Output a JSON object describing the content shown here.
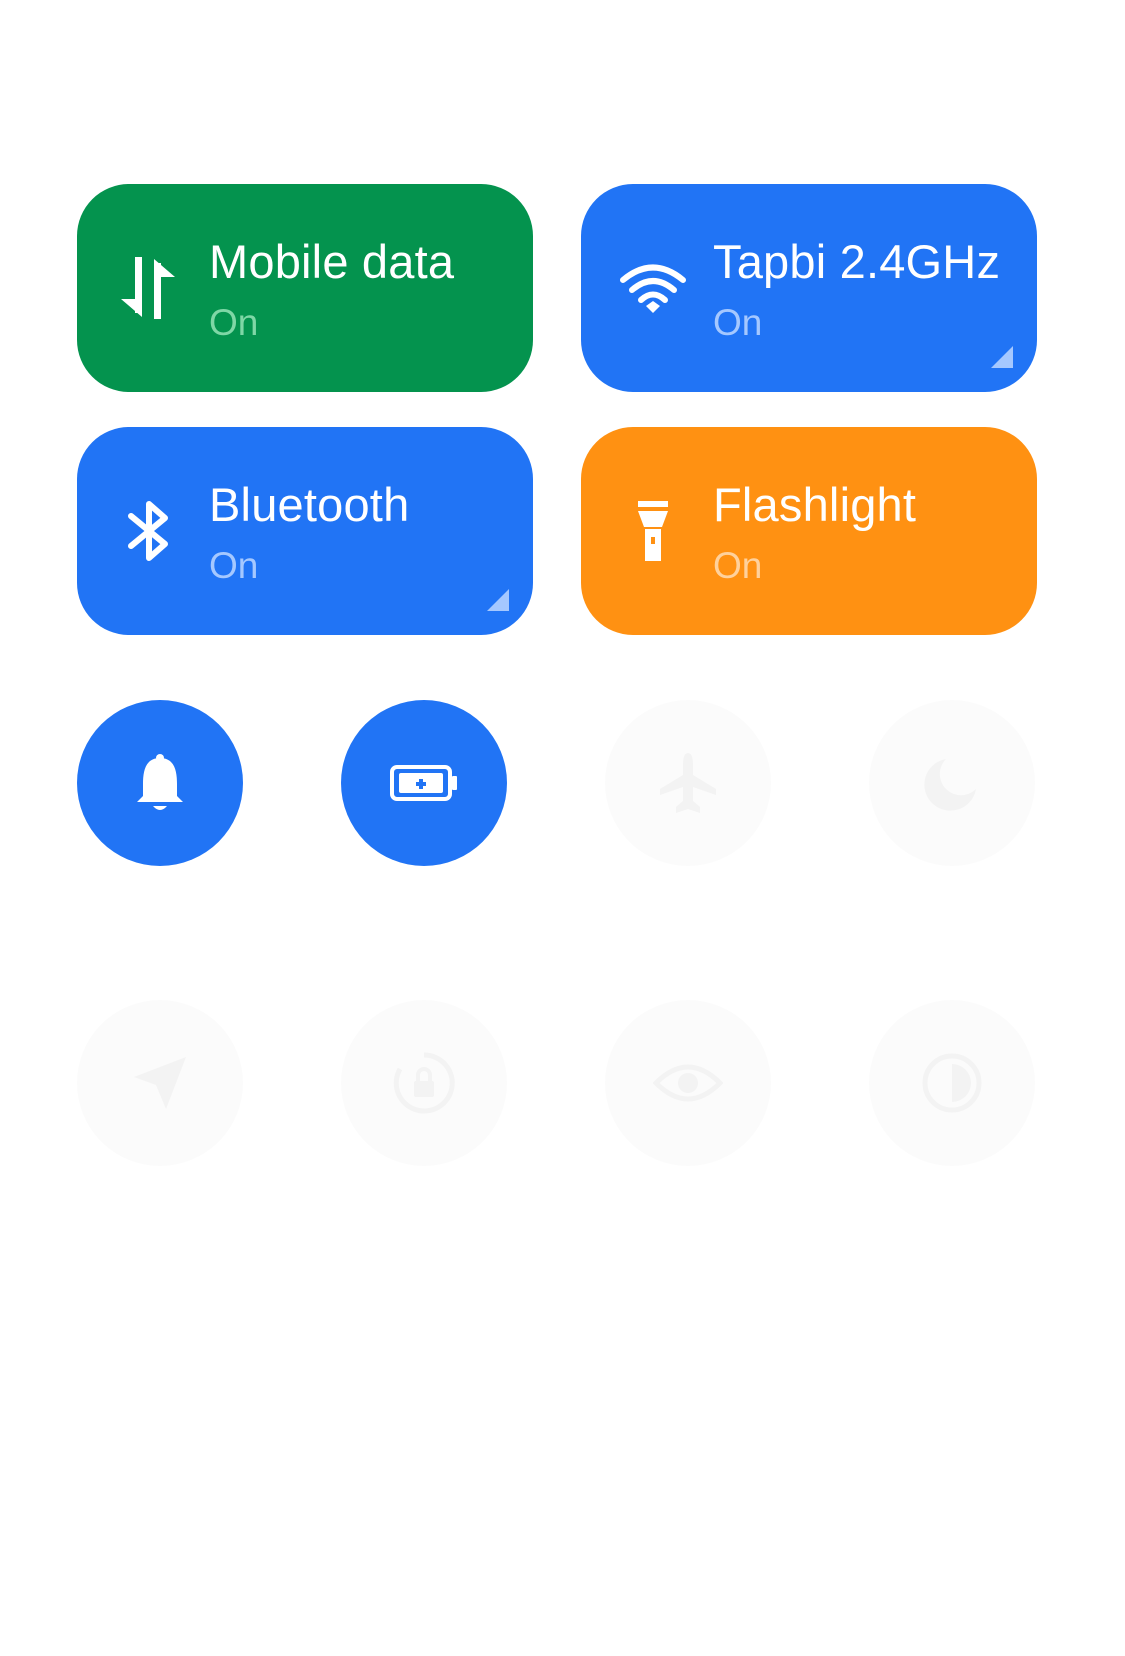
{
  "tiles": {
    "mobile_data": {
      "title": "Mobile data",
      "status": "On",
      "icon": "mobile-data-arrows-icon",
      "color": "#04934e",
      "status_color": "#7fd7a6"
    },
    "wifi": {
      "title": "Tapbi 2.4GHz",
      "status": "On",
      "icon": "wifi-icon",
      "color": "#2174f5",
      "status_color": "#a5c8ff"
    },
    "bluetooth": {
      "title": "Bluetooth",
      "status": "On",
      "icon": "bluetooth-icon",
      "color": "#2174f5",
      "status_color": "#a5c8ff"
    },
    "flashlight": {
      "title": "Flashlight",
      "status": "On",
      "icon": "flashlight-icon",
      "color": "#ff9112",
      "status_color": "#ffd19c"
    }
  },
  "toggles_row1": [
    {
      "icon": "bell-icon",
      "active": true
    },
    {
      "icon": "battery-saver-icon",
      "active": true
    },
    {
      "icon": "airplane-icon",
      "active": false
    },
    {
      "icon": "moon-icon",
      "active": false
    }
  ],
  "toggles_row2": [
    {
      "icon": "location-icon",
      "active": false
    },
    {
      "icon": "rotation-lock-icon",
      "active": false
    },
    {
      "icon": "eye-icon",
      "active": false
    },
    {
      "icon": "dark-mode-icon",
      "active": false
    }
  ],
  "colors": {
    "active_blue": "#2174f5",
    "inactive_bg": "#fbfbfb",
    "inactive_icon": "#f3f3f3"
  }
}
